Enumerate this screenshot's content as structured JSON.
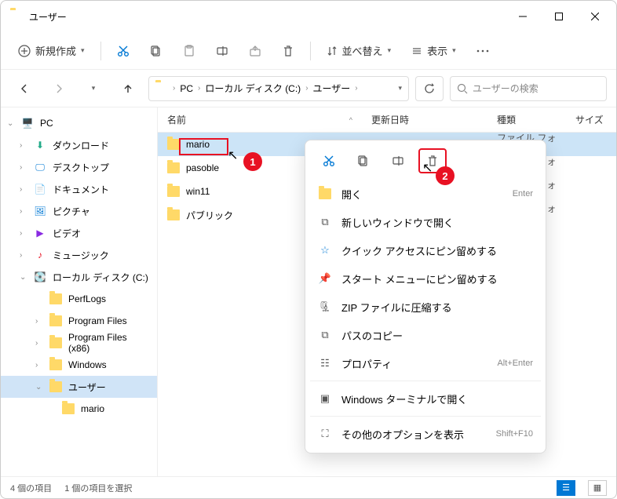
{
  "window": {
    "title": "ユーザー"
  },
  "toolbar": {
    "new": "新規作成",
    "sort": "並べ替え",
    "view": "表示"
  },
  "breadcrumb": {
    "items": [
      "PC",
      "ローカル ディスク (C:)",
      "ユーザー"
    ]
  },
  "search": {
    "placeholder": "ユーザーの検索"
  },
  "sidebar": {
    "pc": "PC",
    "downloads": "ダウンロード",
    "desktop": "デスクトップ",
    "documents": "ドキュメント",
    "pictures": "ピクチャ",
    "videos": "ビデオ",
    "music": "ミュージック",
    "localdisk": "ローカル ディスク (C:)",
    "perflogs": "PerfLogs",
    "programfiles": "Program Files",
    "programfiles86": "Program Files (x86)",
    "windows": "Windows",
    "users": "ユーザー",
    "mario": "mario"
  },
  "columns": {
    "name": "名前",
    "date": "更新日時",
    "type": "種類",
    "size": "サイズ"
  },
  "files": [
    {
      "name": "mario",
      "type": "ファイル フォルダー",
      "selected": true
    },
    {
      "name": "pasoble",
      "type": "ファイル フォルダー",
      "selected": false
    },
    {
      "name": "win11",
      "type": "ファイル フォルダー",
      "selected": false
    },
    {
      "name": "パブリック",
      "type": "ファイル フォルダー",
      "selected": false
    }
  ],
  "context_menu": {
    "open": "開く",
    "open_shortcut": "Enter",
    "new_window": "新しいウィンドウで開く",
    "pin_quick": "クイック アクセスにピン留めする",
    "pin_start": "スタート メニューにピン留めする",
    "zip": "ZIP ファイルに圧縮する",
    "copy_path": "パスのコピー",
    "properties": "プロパティ",
    "properties_shortcut": "Alt+Enter",
    "terminal": "Windows ターミナルで開く",
    "more": "その他のオプションを表示",
    "more_shortcut": "Shift+F10"
  },
  "status": {
    "count": "4 個の項目",
    "selected": "1 個の項目を選択"
  },
  "bubbles": {
    "b1": "1",
    "b2": "2"
  }
}
